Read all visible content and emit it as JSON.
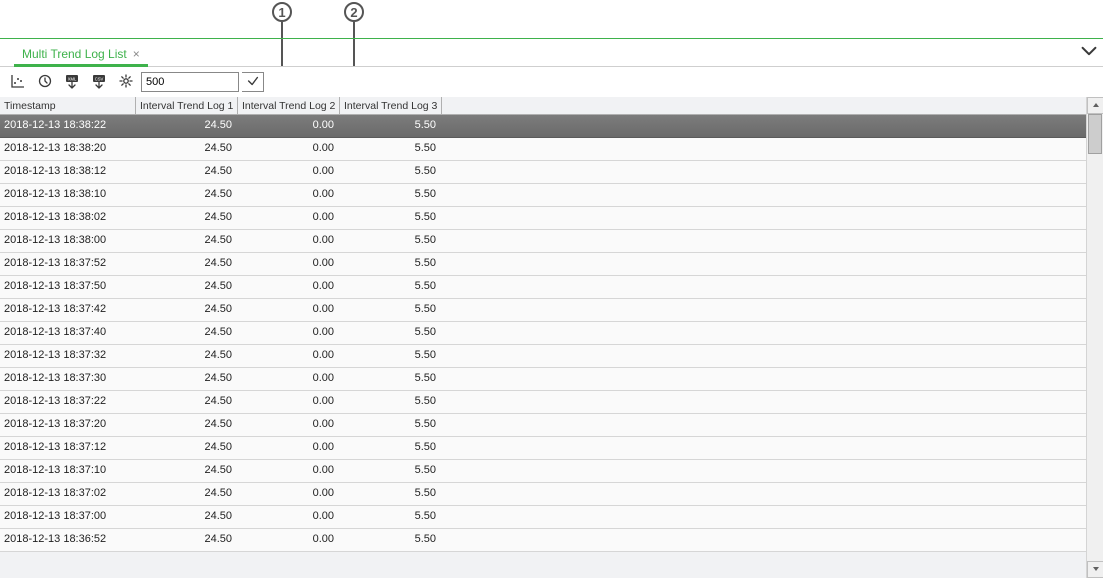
{
  "annotations": {
    "callout1": "1",
    "callout2": "2"
  },
  "tab": {
    "label": "Multi Trend Log List"
  },
  "toolbar": {
    "record_count_value": "500"
  },
  "table": {
    "columns": [
      "Timestamp",
      "Interval Trend Log 1",
      "Interval Trend Log 2",
      "Interval Trend Log 3"
    ],
    "rows": [
      {
        "ts": "2018-12-13 18:38:22",
        "v1": "24.50",
        "v2": "0.00",
        "v3": "5.50",
        "selected": true
      },
      {
        "ts": "2018-12-13 18:38:20",
        "v1": "24.50",
        "v2": "0.00",
        "v3": "5.50",
        "selected": false
      },
      {
        "ts": "2018-12-13 18:38:12",
        "v1": "24.50",
        "v2": "0.00",
        "v3": "5.50",
        "selected": false
      },
      {
        "ts": "2018-12-13 18:38:10",
        "v1": "24.50",
        "v2": "0.00",
        "v3": "5.50",
        "selected": false
      },
      {
        "ts": "2018-12-13 18:38:02",
        "v1": "24.50",
        "v2": "0.00",
        "v3": "5.50",
        "selected": false
      },
      {
        "ts": "2018-12-13 18:38:00",
        "v1": "24.50",
        "v2": "0.00",
        "v3": "5.50",
        "selected": false
      },
      {
        "ts": "2018-12-13 18:37:52",
        "v1": "24.50",
        "v2": "0.00",
        "v3": "5.50",
        "selected": false
      },
      {
        "ts": "2018-12-13 18:37:50",
        "v1": "24.50",
        "v2": "0.00",
        "v3": "5.50",
        "selected": false
      },
      {
        "ts": "2018-12-13 18:37:42",
        "v1": "24.50",
        "v2": "0.00",
        "v3": "5.50",
        "selected": false
      },
      {
        "ts": "2018-12-13 18:37:40",
        "v1": "24.50",
        "v2": "0.00",
        "v3": "5.50",
        "selected": false
      },
      {
        "ts": "2018-12-13 18:37:32",
        "v1": "24.50",
        "v2": "0.00",
        "v3": "5.50",
        "selected": false
      },
      {
        "ts": "2018-12-13 18:37:30",
        "v1": "24.50",
        "v2": "0.00",
        "v3": "5.50",
        "selected": false
      },
      {
        "ts": "2018-12-13 18:37:22",
        "v1": "24.50",
        "v2": "0.00",
        "v3": "5.50",
        "selected": false
      },
      {
        "ts": "2018-12-13 18:37:20",
        "v1": "24.50",
        "v2": "0.00",
        "v3": "5.50",
        "selected": false
      },
      {
        "ts": "2018-12-13 18:37:12",
        "v1": "24.50",
        "v2": "0.00",
        "v3": "5.50",
        "selected": false
      },
      {
        "ts": "2018-12-13 18:37:10",
        "v1": "24.50",
        "v2": "0.00",
        "v3": "5.50",
        "selected": false
      },
      {
        "ts": "2018-12-13 18:37:02",
        "v1": "24.50",
        "v2": "0.00",
        "v3": "5.50",
        "selected": false
      },
      {
        "ts": "2018-12-13 18:37:00",
        "v1": "24.50",
        "v2": "0.00",
        "v3": "5.50",
        "selected": false
      },
      {
        "ts": "2018-12-13 18:36:52",
        "v1": "24.50",
        "v2": "0.00",
        "v3": "5.50",
        "selected": false
      }
    ]
  }
}
